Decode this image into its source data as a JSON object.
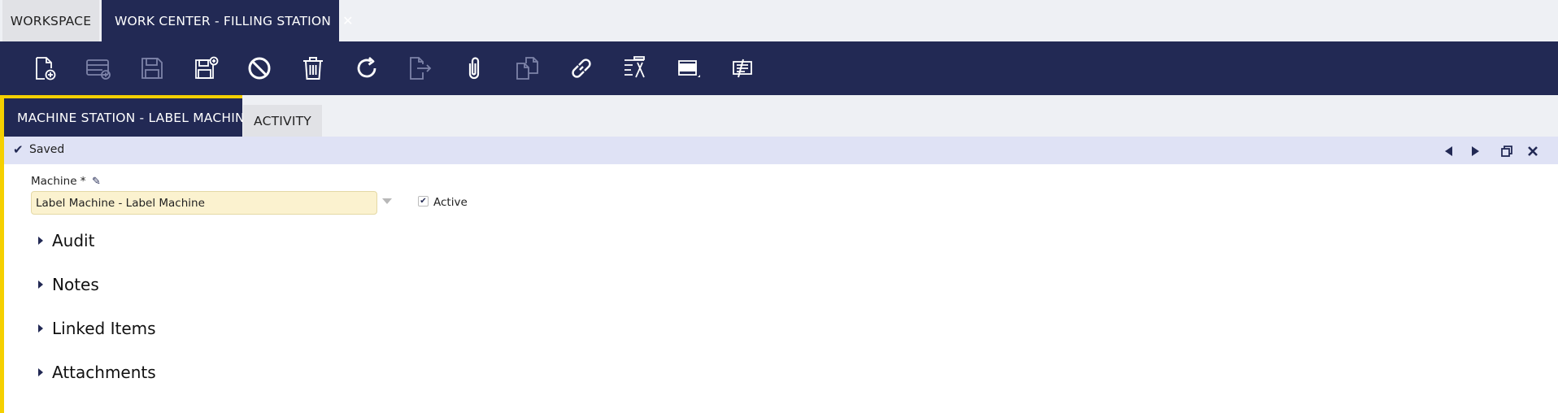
{
  "window_tabs": [
    {
      "label": "WORKSPACE"
    },
    {
      "label": "WORK CENTER - FILLING STATION",
      "close": "✕"
    }
  ],
  "toolbar": {
    "buttons": [
      {
        "name": "new-document-button",
        "icon": "new-document-icon",
        "enabled": true
      },
      {
        "name": "new-row-button",
        "icon": "new-row-icon",
        "enabled": false
      },
      {
        "name": "save-button",
        "icon": "save-icon",
        "enabled": false
      },
      {
        "name": "save-close-button",
        "icon": "save-new-icon",
        "enabled": true
      },
      {
        "name": "undo-button",
        "icon": "cancel-icon",
        "enabled": true
      },
      {
        "name": "delete-button",
        "icon": "trash-icon",
        "enabled": true
      },
      {
        "name": "refresh-button",
        "icon": "refresh-icon",
        "enabled": true
      },
      {
        "name": "export-button",
        "icon": "export-icon",
        "enabled": false
      },
      {
        "name": "attachment-button",
        "icon": "paperclip-icon",
        "enabled": true
      },
      {
        "name": "clone-button",
        "icon": "copy-icon",
        "enabled": false
      },
      {
        "name": "link-button",
        "icon": "link-icon",
        "enabled": true
      },
      {
        "name": "tools-button",
        "icon": "tools-icon",
        "enabled": true
      },
      {
        "name": "toggle-view-button",
        "icon": "form-view-icon",
        "enabled": true
      },
      {
        "name": "notes-button",
        "icon": "notes-icon",
        "enabled": true
      }
    ],
    "colors": {
      "enabled": "#ffffff",
      "disabled": "#7d83a8",
      "background": "#222954"
    }
  },
  "sub_tabs": [
    {
      "label": "MACHINE STATION - LABEL MACHIN..."
    },
    {
      "label": "ACTIVITY"
    }
  ],
  "status": {
    "icon": "checkmark-icon",
    "text": "Saved"
  },
  "form": {
    "machine_label": "Machine *",
    "machine_value": "Label Machine - Label Machine",
    "active_label": "Active",
    "active_checked": true
  },
  "sections": [
    {
      "label": "Audit"
    },
    {
      "label": "Notes"
    },
    {
      "label": "Linked Items"
    },
    {
      "label": "Attachments"
    }
  ],
  "colors": {
    "accent": "#222954",
    "highlight": "#f5d000",
    "status_bg": "#dfe2f5",
    "input_bg": "#fbf2cf"
  }
}
